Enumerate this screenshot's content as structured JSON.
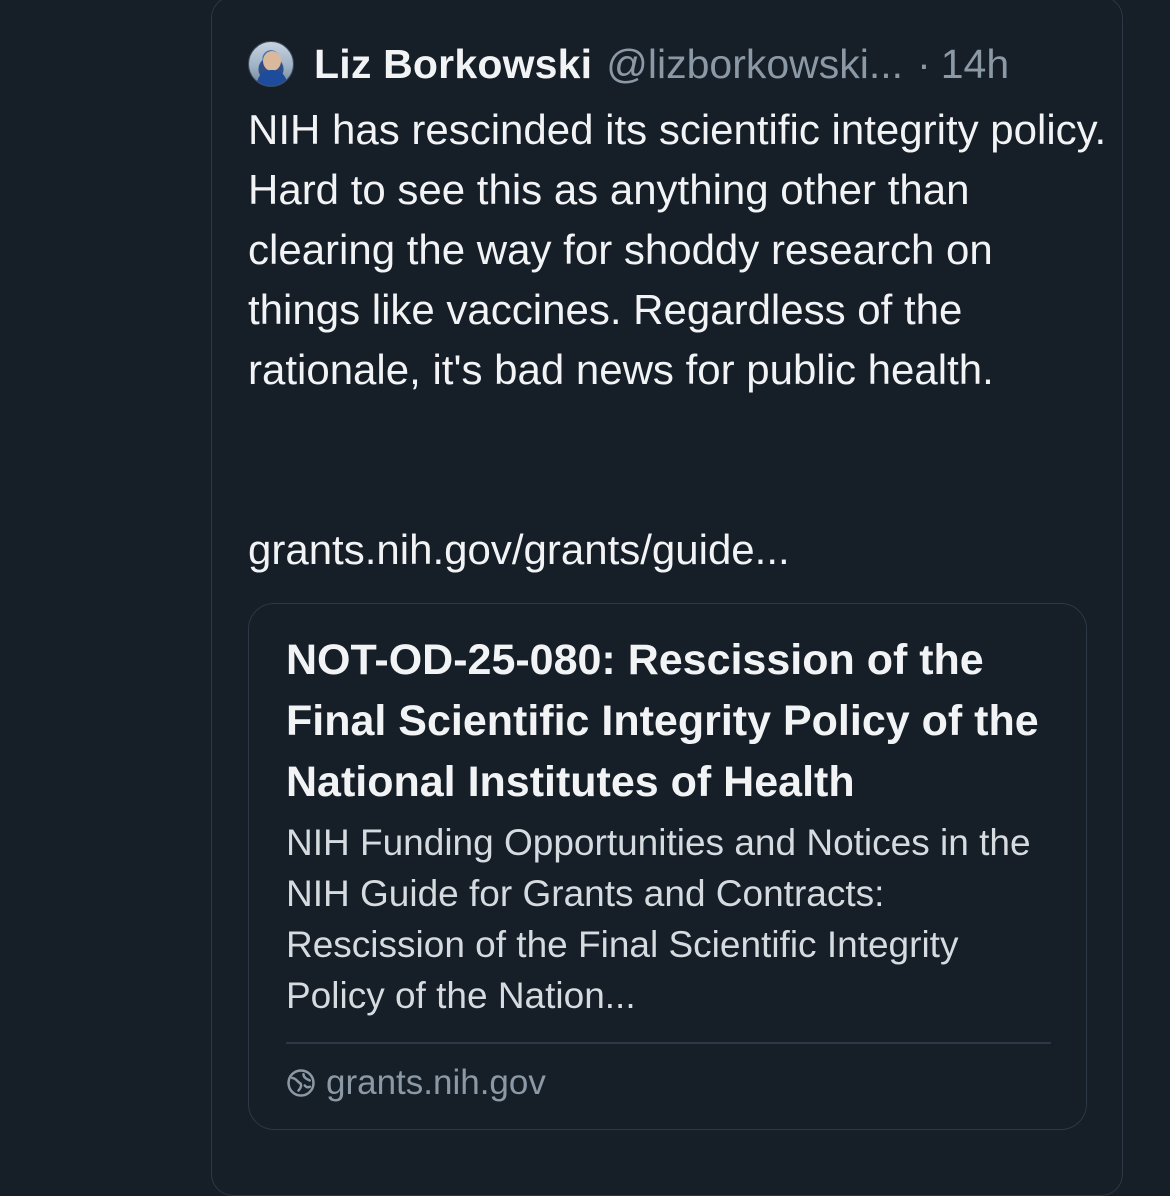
{
  "post": {
    "author": {
      "name": "Liz Borkowski",
      "handle": "@lizborkowski...",
      "separator": "·",
      "time": "14h",
      "avatar_icon": "avatar-photo"
    },
    "text": "NIH has rescinded its scientific integrity policy. Hard to see this as anything other than clearing the way for shoddy research on things like vaccines. Regardless of the rationale, it's bad news for public health.",
    "link_text": "grants.nih.gov/grants/guide..."
  },
  "link_card": {
    "title": "NOT-OD-25-080: Rescission of the Final Scientific Integrity Policy of the National Institutes of Health",
    "description": "NIH Funding Opportunities and Notices in the NIH Guide for Grants and Contracts: Rescission of the Final Scientific Integrity Policy of the Nation...",
    "domain": "grants.nih.gov",
    "domain_icon": "globe-icon"
  },
  "colors": {
    "background": "#161e27",
    "text_primary": "#f1f3f5",
    "text_secondary": "#8b98a5",
    "border": "#2c3845"
  }
}
